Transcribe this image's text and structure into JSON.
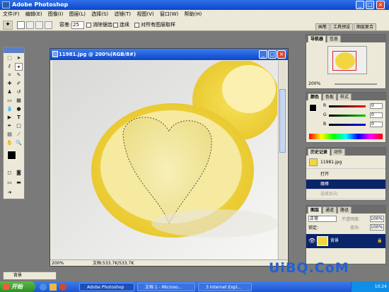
{
  "app": {
    "title": "Adobe Photoshop"
  },
  "menu": [
    "文件(F)",
    "编辑(E)",
    "图像(I)",
    "图层(L)",
    "选择(S)",
    "滤镜(T)",
    "视图(V)",
    "窗口(W)",
    "帮助(H)"
  ],
  "options": {
    "tolerance_label": "容差:",
    "tolerance_value": "25",
    "antialias_label": "消除锯齿",
    "contiguous_label": "连续",
    "all_layers_label": "对所有图层取样",
    "palette_tabs": [
      "画笔",
      "工具预设",
      "图层复合"
    ]
  },
  "document": {
    "title": "11981.jpg @ 200%(RGB/8#)",
    "zoom": "200%",
    "doc_size": "文档:533.7K/533.7K"
  },
  "navigator": {
    "tabs": [
      "导航器",
      "信息"
    ],
    "zoom": "200%"
  },
  "color": {
    "tabs": [
      "颜色",
      "色板",
      "样式"
    ],
    "r_label": "R",
    "g_label": "G",
    "b_label": "B",
    "r": "0",
    "g": "0",
    "b": "0"
  },
  "history": {
    "tabs": [
      "历史记录",
      "动作"
    ],
    "snapshot": "11981.jpg",
    "items": [
      "打开",
      "魔棒",
      "选择反向"
    ]
  },
  "layers": {
    "tabs": [
      "图层",
      "通道",
      "路径"
    ],
    "mode": "正常",
    "opacity_label": "不透明度:",
    "opacity": "100%",
    "lock_label": "锁定:",
    "fill_label": "填充:",
    "fill": "100%",
    "layer_name": "背景"
  },
  "bottom_bar": {
    "label": "背景"
  },
  "taskbar": {
    "start": "开始",
    "items": [
      "Adobe Photoshop",
      "文档 1 - Microso...",
      "3 Internet Expl..."
    ],
    "clock": "10:24"
  },
  "watermark": "UiBQ.CoM",
  "colors": {
    "titlebar": "#0c46c9",
    "lemon": "#f2d640",
    "pulp": "#f3ea9a"
  }
}
